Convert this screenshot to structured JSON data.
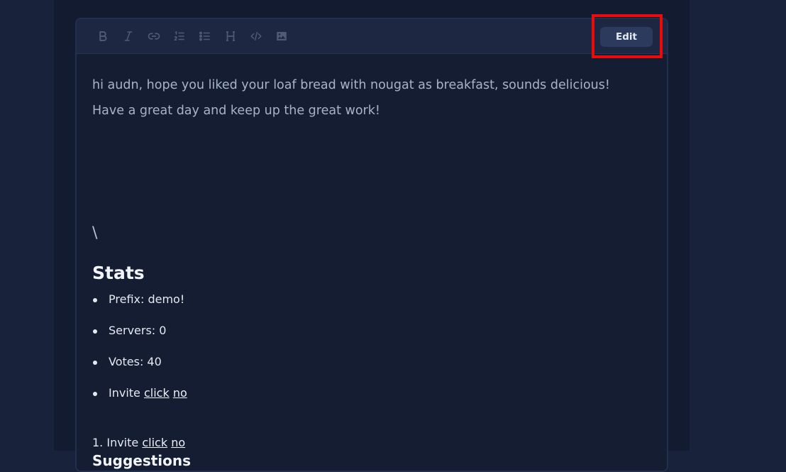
{
  "toolbar": {
    "tools": [
      {
        "icon": "bold-icon"
      },
      {
        "icon": "italic-icon"
      },
      {
        "icon": "link-icon"
      },
      {
        "icon": "ordered-list-icon"
      },
      {
        "icon": "unordered-list-icon"
      },
      {
        "icon": "heading-icon"
      },
      {
        "icon": "code-icon"
      },
      {
        "icon": "image-icon"
      }
    ],
    "edit_label": "Edit"
  },
  "content": {
    "line1": "hi audn, hope you liked your loaf bread with nougat as breakfast, sounds delicious!",
    "line2": "Have a great day and keep up the great work!",
    "backslash": "\\",
    "stats_heading": "Stats",
    "stats": {
      "prefix": "Prefix: demo!",
      "servers": "Servers: 0",
      "votes": "Votes: 40",
      "invite_label": "Invite",
      "invite_link1": "click",
      "invite_link2": "no"
    },
    "numbered": {
      "label": "1. Invite",
      "link1": "click",
      "link2": "no"
    },
    "suggestions_heading": "Suggestions"
  },
  "colors": {
    "highlight": "#ec0a0a",
    "background": "#121b2f",
    "toolbar": "#1d2741"
  }
}
